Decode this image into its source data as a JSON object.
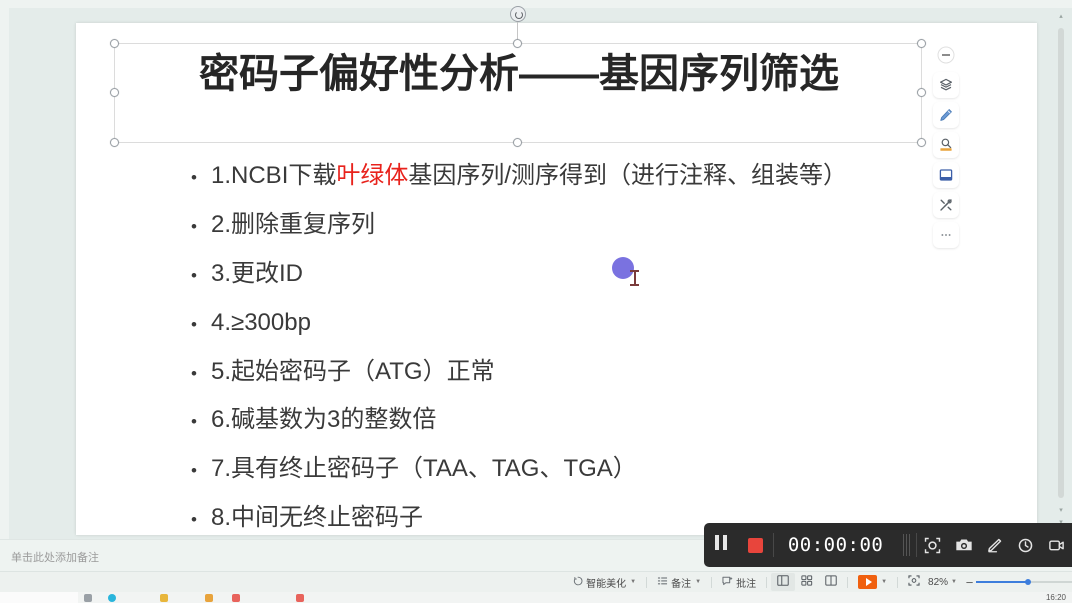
{
  "slide": {
    "title": "密码子偏好性分析——基因序列筛选",
    "bullets": [
      {
        "marker": "•",
        "pre": "1.NCBI下载",
        "highlight": "叶绿体",
        "post": "基因序列/测序得到（进行注释、组装等）"
      },
      {
        "marker": "•",
        "pre": "2.删除重复序列",
        "highlight": "",
        "post": ""
      },
      {
        "marker": "•",
        "pre": "3.更改ID",
        "highlight": "",
        "post": ""
      },
      {
        "marker": "•",
        "pre": "4.≥300bp",
        "highlight": "",
        "post": ""
      },
      {
        "marker": "•",
        "pre": "5.起始密码子（ATG）正常",
        "highlight": "",
        "post": ""
      },
      {
        "marker": "•",
        "pre": "6.碱基数为3的整数倍",
        "highlight": "",
        "post": ""
      },
      {
        "marker": "•",
        "pre": "7.具有终止密码子（TAA、TAG、TGA）",
        "highlight": "",
        "post": ""
      },
      {
        "marker": "•",
        "pre": "8.中间无终止密码子",
        "highlight": "",
        "post": ""
      }
    ],
    "highlight_color": "#e8221c"
  },
  "tool_rail": {
    "items": [
      {
        "name": "collapse-rail",
        "icon": "minus-icon"
      },
      {
        "name": "layers",
        "icon": "layers-icon"
      },
      {
        "name": "pen",
        "icon": "pen-icon"
      },
      {
        "name": "stamp",
        "icon": "stamp-icon"
      },
      {
        "name": "frame",
        "icon": "frame-icon"
      },
      {
        "name": "tools",
        "icon": "tools-icon"
      },
      {
        "name": "more",
        "icon": "ellipsis-icon"
      }
    ]
  },
  "notes": {
    "placeholder": "单击此处添加备注"
  },
  "status_bar": {
    "beautify_label": "智能美化",
    "notes_label": "备注",
    "comment_label": "批注",
    "view_normal": "normal-view-icon",
    "view_grid": "grid-view-icon",
    "view_reading": "reading-view-icon",
    "play_label": "play-icon",
    "fit_label": "fit-to-window-icon",
    "zoom_percent": "82%",
    "zoom_minus": "−",
    "accent_play": "#f0600f",
    "accent_slider": "#3d7ddc"
  },
  "recorder": {
    "pause_label": "pause-icon",
    "stop_label": "stop-icon",
    "timer": "00:00:00",
    "tools": [
      {
        "name": "region-select",
        "icon": "region-select-icon"
      },
      {
        "name": "screenshot",
        "icon": "camera-icon"
      },
      {
        "name": "annotate-pen",
        "icon": "pen-icon"
      },
      {
        "name": "timer",
        "icon": "clock-icon"
      },
      {
        "name": "webcam",
        "icon": "webcam-icon"
      }
    ],
    "stop_color": "#e8453c",
    "background": "#2b2b2b"
  },
  "taskbar": {
    "clock": "16:20"
  },
  "pointer": {
    "dot_color": "#7a72e0",
    "cursor": "i-beam-cursor"
  }
}
